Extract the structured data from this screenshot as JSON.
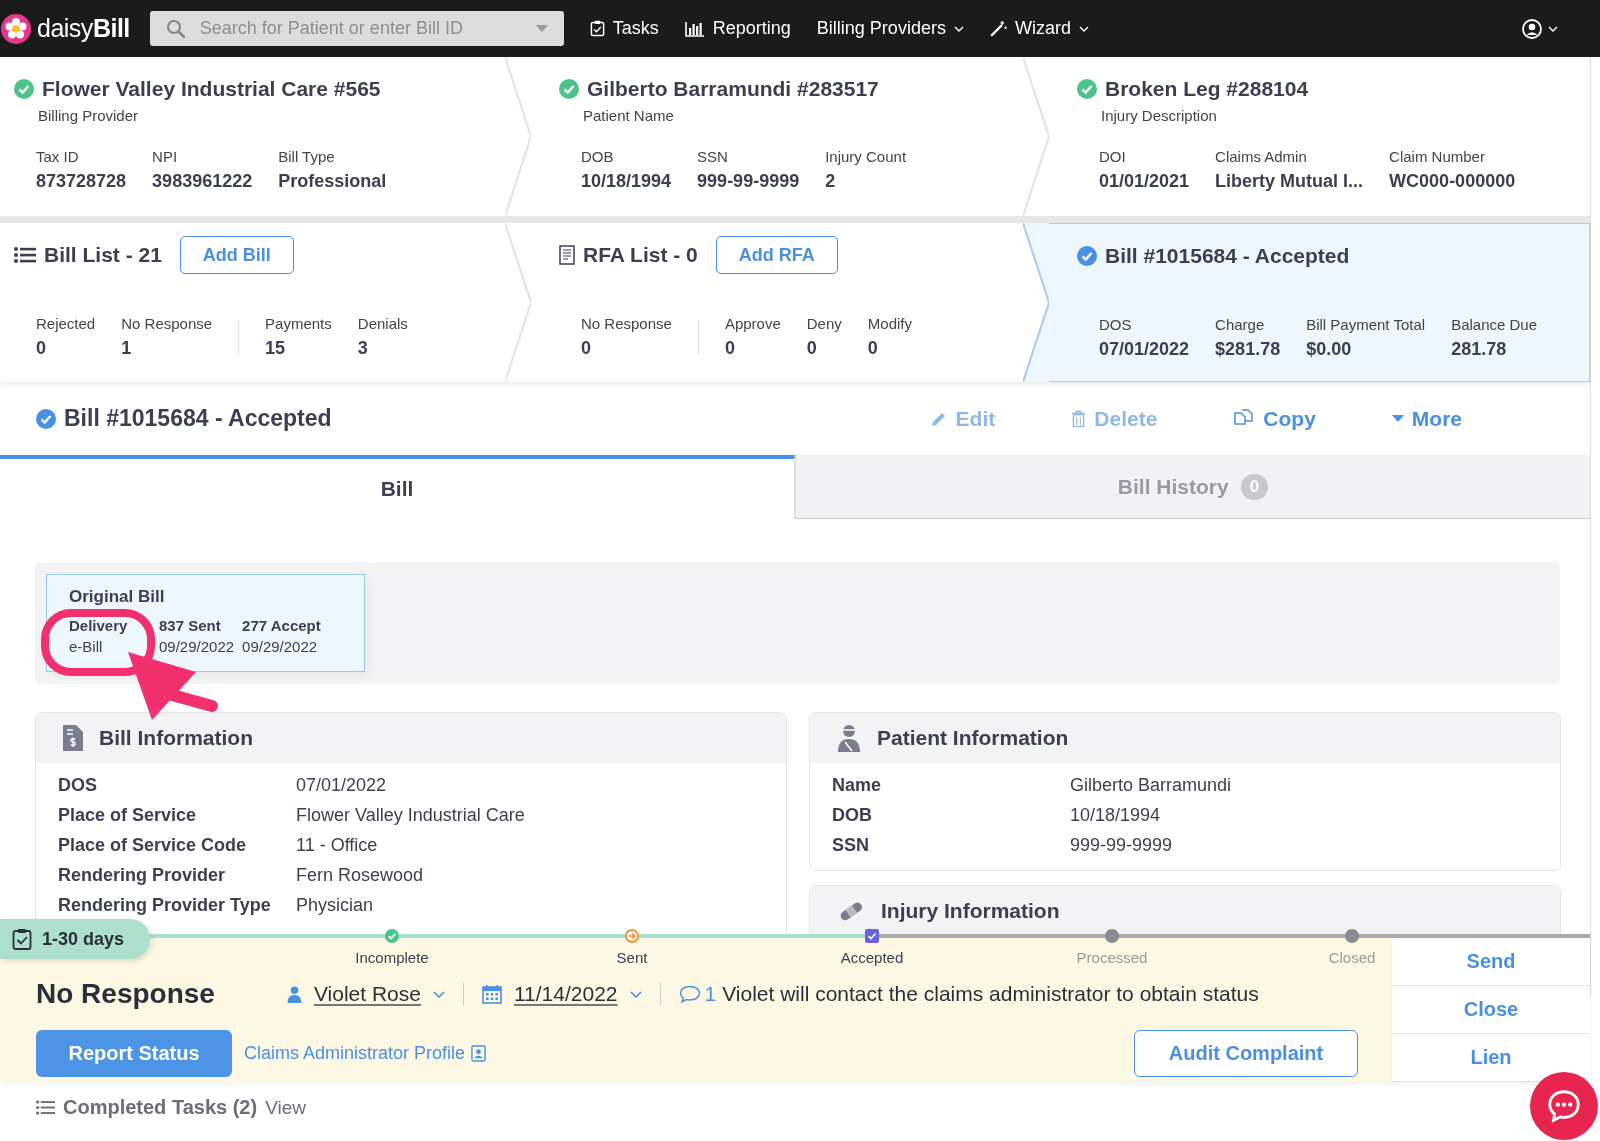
{
  "nav": {
    "logo": "daisy**Bill**",
    "search": {
      "placeholder": "Search for Patient or enter Bill ID"
    },
    "items": [
      {
        "label": "Tasks",
        "dropdown": false
      },
      {
        "label": "Reporting",
        "dropdown": false
      },
      {
        "label": "Billing Providers",
        "dropdown": true
      },
      {
        "label": "Wizard",
        "dropdown": true
      }
    ]
  },
  "summary_top": [
    {
      "title": "Flower Valley Industrial Care #565",
      "verified": true,
      "subtitle": "Billing Provider",
      "fields": [
        {
          "label": "Tax ID",
          "value": "873728728"
        },
        {
          "label": "NPI",
          "value": "3983961222"
        },
        {
          "label": "Bill Type",
          "value": "Professional"
        }
      ]
    },
    {
      "title": "Gilberto Barramundi #283517",
      "verified": true,
      "subtitle": "Patient Name",
      "fields": [
        {
          "label": "DOB",
          "value": "10/18/1994"
        },
        {
          "label": "SSN",
          "value": "999-99-9999"
        },
        {
          "label": "Injury Count",
          "value": "2"
        }
      ]
    },
    {
      "title": "Broken Leg #288104",
      "verified": true,
      "subtitle": "Injury Description",
      "fields": [
        {
          "label": "DOI",
          "value": "01/01/2021"
        },
        {
          "label": "Claims Admin",
          "value": "Liberty Mutual I..."
        },
        {
          "label": "Claim Number",
          "value": "WC000-000000"
        }
      ]
    }
  ],
  "summary_bottom": [
    {
      "kind": "bill_list",
      "title": "Bill List - 21",
      "button": "Add Bill",
      "selected": false,
      "groups": [
        [
          {
            "label": "Rejected",
            "value": "0"
          },
          {
            "label": "No Response",
            "value": "1"
          }
        ],
        [
          {
            "label": "Payments",
            "value": "15"
          },
          {
            "label": "Denials",
            "value": "3"
          }
        ]
      ]
    },
    {
      "kind": "rfa_list",
      "title": "RFA List - 0",
      "button": "Add RFA",
      "selected": false,
      "groups": [
        [
          {
            "label": "No Response",
            "value": "0"
          }
        ],
        [
          {
            "label": "Approve",
            "value": "0"
          },
          {
            "label": "Deny",
            "value": "0"
          },
          {
            "label": "Modify",
            "value": "0"
          }
        ]
      ]
    },
    {
      "kind": "bill",
      "title": "Bill #1015684 - Accepted",
      "selected": true,
      "groups": [
        [
          {
            "label": "DOS",
            "value": "07/01/2022"
          },
          {
            "label": "Charge",
            "value": "$281.78"
          },
          {
            "label": "Bill Payment Total",
            "value": "$0.00"
          },
          {
            "label": "Balance Due",
            "value": "281.78"
          }
        ]
      ]
    }
  ],
  "bill_header": {
    "title": "Bill #1015684 - Accepted",
    "verified": true,
    "actions": [
      {
        "label": "Edit",
        "disabled": true
      },
      {
        "label": "Delete",
        "disabled": true
      },
      {
        "label": "Copy",
        "disabled": false
      },
      {
        "label": "More",
        "disabled": false
      }
    ]
  },
  "tabs": [
    {
      "label": "Bill",
      "selected": true
    },
    {
      "label": "Bill History",
      "count": "0",
      "selected": false
    }
  ],
  "original_bill": {
    "title": "Original Bill",
    "columns": [
      {
        "label": "Delivery",
        "value": "e-Bill"
      },
      {
        "label": "837 Sent",
        "value": "09/29/2022"
      },
      {
        "label": "277 Accept",
        "value": "09/29/2022"
      }
    ]
  },
  "bill_information": {
    "title": "Bill Information",
    "rows": [
      {
        "label": "DOS",
        "value": "07/01/2022"
      },
      {
        "label": "Place of Service",
        "value": "Flower Valley Industrial Care"
      },
      {
        "label": "Place of Service Code",
        "value": "11 - Office"
      },
      {
        "label": "Rendering Provider",
        "value": "Fern Rosewood"
      },
      {
        "label": "Rendering Provider Type",
        "value": "Physician"
      }
    ]
  },
  "patient_information": {
    "title": "Patient Information",
    "rows": [
      {
        "label": "Name",
        "value": "Gilberto Barramundi"
      },
      {
        "label": "DOB",
        "value": "10/18/1994"
      },
      {
        "label": "SSN",
        "value": "999-99-9999"
      }
    ]
  },
  "injury_information": {
    "title": "Injury Information"
  },
  "task": {
    "age": "1-30 days",
    "stages": [
      {
        "label": "Incomplete",
        "kind": "complete",
        "reached": true
      },
      {
        "label": "Sent",
        "kind": "sent",
        "reached": true
      },
      {
        "label": "Accepted",
        "kind": "accepted",
        "reached": true
      },
      {
        "label": "Processed",
        "kind": "pending",
        "reached": false
      },
      {
        "label": "Closed",
        "kind": "pending",
        "reached": false
      }
    ],
    "status": "No Response",
    "assignee": "Violet Rose",
    "due_date": "11/14/2022",
    "comment_count": "1",
    "comment": "Violet will contact the claims administrator to obtain status",
    "primary_button": "Report Status",
    "link": "Claims Administrator Profile",
    "secondary_button": "Audit Complaint",
    "side_actions": [
      "Send",
      "Close",
      "Lien"
    ]
  },
  "completed_tasks": {
    "label": "Completed Tasks (2)",
    "link": "View"
  }
}
